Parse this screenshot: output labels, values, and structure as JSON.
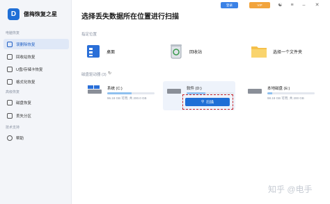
{
  "app": {
    "name": "傲梅恢复之星",
    "logo_letter": "D"
  },
  "sidebar": {
    "sections": [
      {
        "label": "电脑恢复",
        "items": [
          {
            "label": "误删除恢复",
            "active": true
          },
          {
            "label": "回收站恢复"
          },
          {
            "label": "U盘/存储卡恢复"
          },
          {
            "label": "格式化恢复"
          }
        ]
      },
      {
        "label": "高级恢复",
        "items": [
          {
            "label": "磁盘恢复"
          },
          {
            "label": "丢失分区"
          }
        ]
      },
      {
        "label": "技术支持",
        "items": [
          {
            "label": "帮助"
          }
        ]
      }
    ]
  },
  "header": {
    "title": "选择丢失数据所在位置进行扫描",
    "login_label": "登录",
    "vip_label": "VIP"
  },
  "locations": {
    "section_label": "指定位置",
    "items": [
      {
        "label": "桌面",
        "icon": "desktop-icon"
      },
      {
        "label": "回收站",
        "icon": "recycle-bin-icon"
      },
      {
        "label": "选择一个文件夹",
        "icon": "folder-icon"
      }
    ]
  },
  "drives": {
    "section_label": "磁盘驱动器 (3)",
    "items": [
      {
        "name": "系统 (C:)",
        "size": "96.18 GB 可用, 共 200.0 GB",
        "used_fraction": 0.52
      },
      {
        "name": "软件 (D:)",
        "size": "",
        "used_fraction": 0.4
      },
      {
        "name": "本地磁盘 (E:)",
        "size": "98.18 GB 可用, 共 200 GB",
        "used_fraction": 0.1
      }
    ],
    "scan_label": "扫描"
  },
  "watermark": "知乎 @电手",
  "colors": {
    "accent": "#1f6fd6",
    "vip": "#f2a43c",
    "highlight": "#c8252b"
  }
}
